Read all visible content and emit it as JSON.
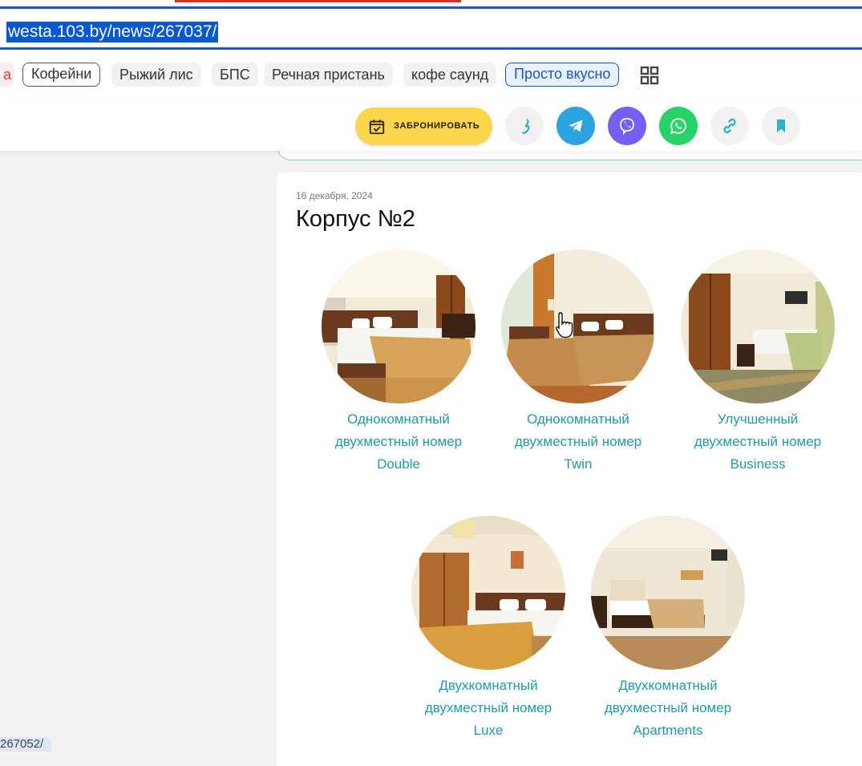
{
  "browser": {
    "address": "westa.103.by/news/267037/",
    "status_url": "267052/"
  },
  "chips": [
    {
      "label": "а"
    },
    {
      "label": "Кофейни"
    },
    {
      "label": "Рыжий лис"
    },
    {
      "label": "БПС"
    },
    {
      "label": "Речная пристань"
    },
    {
      "label": "кофе саунд"
    },
    {
      "label": "Просто вкусно"
    }
  ],
  "header": {
    "book_label": "ЗАБРОНИРОВАТЬ",
    "icons": [
      "phone-icon",
      "telegram-icon",
      "viber-icon",
      "whatsapp-icon",
      "link-icon",
      "bookmark-icon"
    ],
    "colors": {
      "book": "#fcd54a",
      "telegram": "#2aa3e0",
      "viber": "#7360f2",
      "whatsapp": "#25d366",
      "neutral": "#f1f1f1",
      "accent_teal": "#2cb5c0"
    }
  },
  "article": {
    "date": "16 декабря, 2024",
    "title": "Корпус №2",
    "rooms": [
      {
        "line1": "Однокомнатный",
        "line2": "двухместный номер",
        "line3": "Double"
      },
      {
        "line1": "Однокомнатный",
        "line2": "двухместный номер",
        "line3": "Twin"
      },
      {
        "line1": "Улучшенный",
        "line2": "двухместный номер",
        "line3": "Business"
      },
      {
        "line1": "Двухкомнатный",
        "line2": "двухместный номер",
        "line3": "Luxe"
      },
      {
        "line1": "Двухкомнатный",
        "line2": "двухместный номер",
        "line3": "Apartments"
      }
    ]
  }
}
